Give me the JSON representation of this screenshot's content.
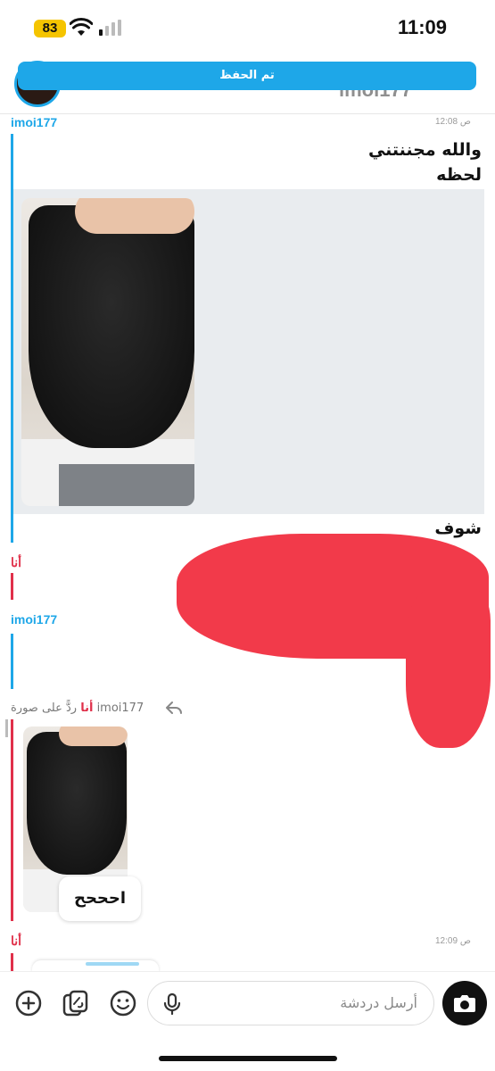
{
  "status_bar": {
    "battery": "83",
    "time": "11:09"
  },
  "header": {
    "title": "imoi177",
    "toast": "تم الحفظ"
  },
  "messages": [
    {
      "sender": "imoi177",
      "time": "12:08 ص",
      "lines": [
        "والله مجننتني",
        "لحظه"
      ],
      "after_media": "شوف"
    },
    {
      "sender": "أنا"
    },
    {
      "sender": "imoi177"
    },
    {
      "sender": "أنا",
      "reply_meta": "ردًّ على صورة imoi177",
      "reply_text": "احححح"
    },
    {
      "sender": "أنا",
      "time": "12:09 ص"
    }
  ],
  "composer": {
    "placeholder": "أرسل دردشة"
  },
  "icons": [
    "plus-icon",
    "sticker-icon",
    "emoji-icon",
    "mic-icon",
    "camera-icon",
    "reply-arrow-icon",
    "wifi-icon",
    "signal-icon"
  ],
  "colors": {
    "accent": "#1ea7e8",
    "me": "#e0304a",
    "redaction": "#f23a4a"
  }
}
